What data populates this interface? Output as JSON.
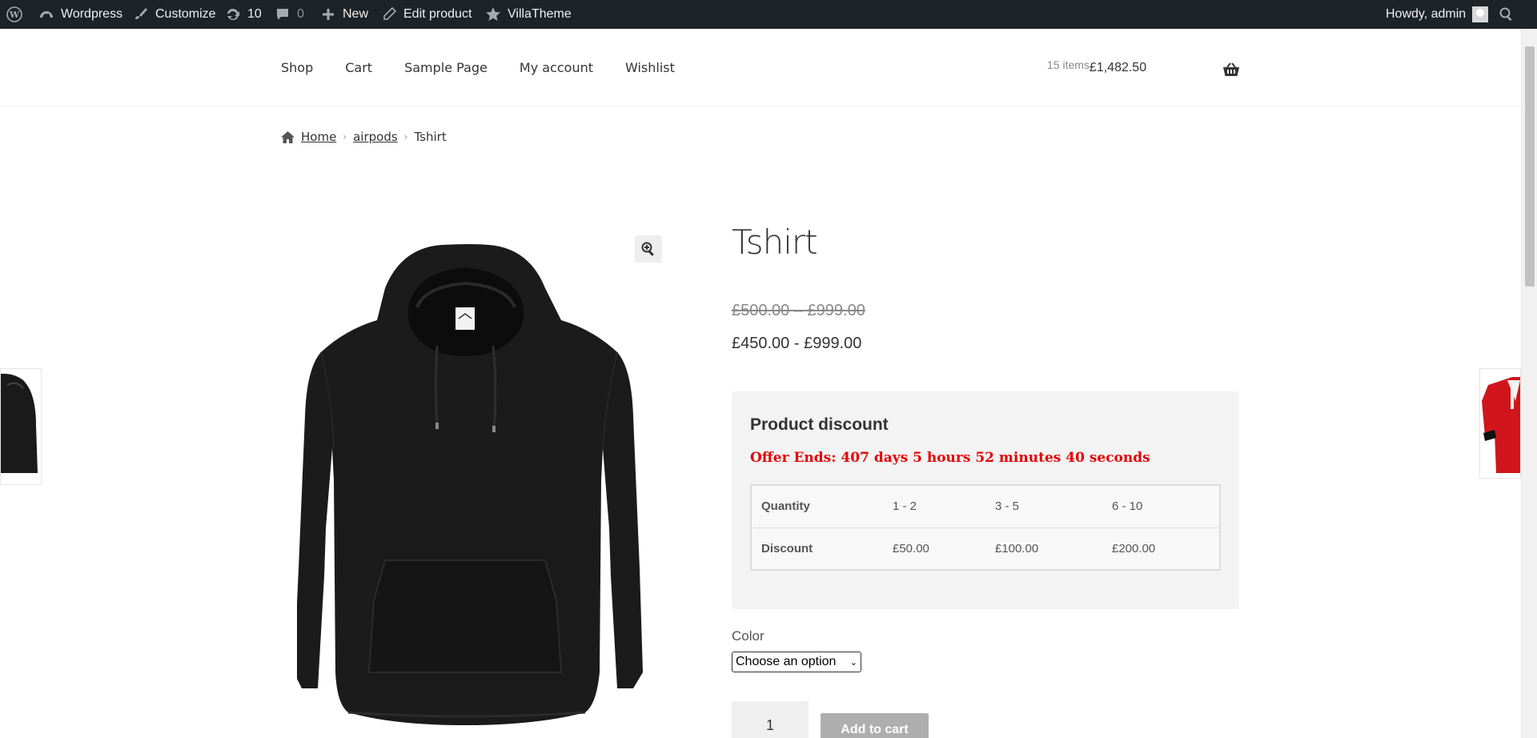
{
  "adminbar": {
    "wp_logo": "wordpress-logo-icon",
    "site_name": "Wordpress",
    "customize": "Customize",
    "updates_count": "10",
    "comments_count": "0",
    "new_label": "New",
    "edit_product": "Edit product",
    "villatheme": "VillaTheme",
    "howdy": "Howdy, admin"
  },
  "nav": {
    "items": [
      "Shop",
      "Cart",
      "Sample Page",
      "My account",
      "Wishlist"
    ]
  },
  "cart": {
    "count": "15 items",
    "total": "£1,482.50"
  },
  "breadcrumb": {
    "home": "Home",
    "category": "airpods",
    "current": "Tshirt"
  },
  "product": {
    "title": "Tshirt",
    "old_price": "£500.00 – £999.00",
    "new_price": "£450.00 - £999.00"
  },
  "discount": {
    "title": "Product discount",
    "offer_ends": "Offer Ends: 407 days 5 hours 52 minutes 40 seconds",
    "table": {
      "quantity_label": "Quantity",
      "quantities": [
        "1 - 2",
        "3 - 5",
        "6 - 10"
      ],
      "discount_label": "Discount",
      "discounts": [
        "£50.00",
        "£100.00",
        "£200.00"
      ]
    }
  },
  "variation": {
    "color_label": "Color",
    "color_selected": "Choose an option"
  },
  "add_to_cart": {
    "quantity": "1",
    "button": "Add to cart"
  },
  "colors": {
    "adminbar_bg": "#1d2327",
    "offer_red": "#e40000",
    "discount_bg": "#f3f3f3",
    "button_bg": "#aeaeae"
  }
}
